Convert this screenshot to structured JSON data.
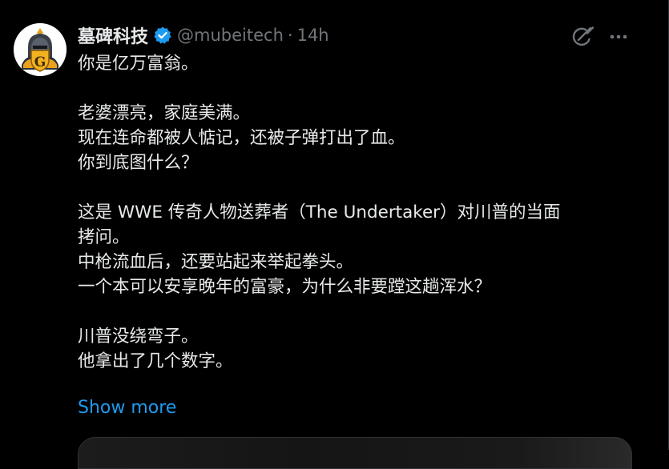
{
  "author": {
    "display_name": "墓碑科技",
    "handle": "@mubeitech",
    "separator": "·",
    "time": "14h",
    "avatar_icon": "knight-helmet-logo-icon",
    "avatar_letter": "G"
  },
  "icons": {
    "verified": "verified-badge-icon",
    "grok": "grok-icon",
    "more": "more-options-icon"
  },
  "colors": {
    "background": "#000000",
    "text": "#e7e9ea",
    "secondary": "#71767b",
    "accent": "#1d9bf0"
  },
  "tweet": {
    "lines": [
      "你是亿万富翁。",
      "",
      "老婆漂亮，家庭美满。",
      "现在连命都被人惦记，还被子弹打出了血。",
      "你到底图什么？",
      "",
      "这是 WWE 传奇人物送葬者（The Undertaker）对川普的当面",
      "拷问。",
      "中枪流血后，还要站起来举起拳头。",
      "一个本可以安享晚年的富豪，为什么非要蹚这趟浑水？",
      "",
      "川普没绕弯子。",
      "他拿出了几个数字。"
    ],
    "show_more": "Show more"
  }
}
